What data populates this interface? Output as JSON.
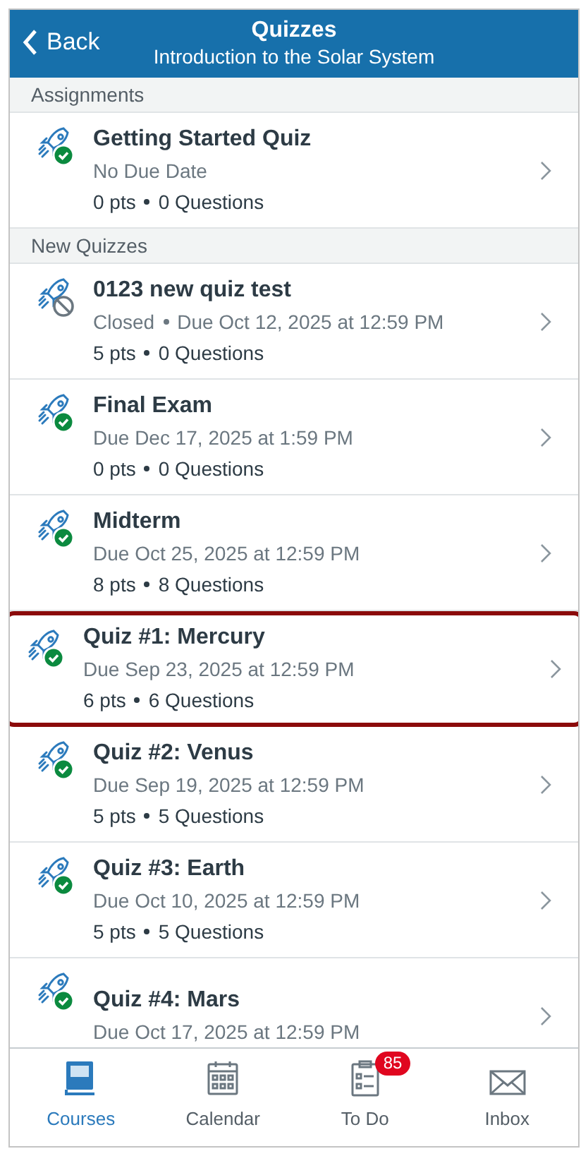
{
  "header": {
    "back": "Back",
    "title": "Quizzes",
    "subtitle": "Introduction to the Solar System"
  },
  "sections": [
    {
      "title": "Assignments",
      "items": [
        {
          "title": "Getting Started Quiz",
          "kind": "published",
          "highlighted": false,
          "details": [
            "No Due Date"
          ],
          "stats": [
            "0 pts",
            "0 Questions"
          ]
        }
      ]
    },
    {
      "title": "New Quizzes",
      "items": [
        {
          "title": "0123 new quiz test",
          "kind": "closed",
          "highlighted": false,
          "details": [
            "Closed",
            "Due Oct 12, 2025 at 12:59 PM"
          ],
          "stats": [
            "5 pts",
            "0 Questions"
          ]
        },
        {
          "title": "Final Exam",
          "kind": "published",
          "highlighted": false,
          "details": [
            "Due Dec 17, 2025 at 1:59 PM"
          ],
          "stats": [
            "0 pts",
            "0 Questions"
          ]
        },
        {
          "title": "Midterm",
          "kind": "published",
          "highlighted": false,
          "details": [
            "Due Oct 25, 2025 at 12:59 PM"
          ],
          "stats": [
            "8 pts",
            "8 Questions"
          ]
        },
        {
          "title": "Quiz #1: Mercury",
          "kind": "published",
          "highlighted": true,
          "details": [
            "Due Sep 23, 2025 at 12:59 PM"
          ],
          "stats": [
            "6 pts",
            "6 Questions"
          ]
        },
        {
          "title": "Quiz #2: Venus",
          "kind": "published",
          "highlighted": false,
          "details": [
            "Due Sep 19, 2025 at 12:59 PM"
          ],
          "stats": [
            "5 pts",
            "5 Questions"
          ]
        },
        {
          "title": "Quiz #3: Earth",
          "kind": "published",
          "highlighted": false,
          "details": [
            "Due Oct 10, 2025 at 12:59 PM"
          ],
          "stats": [
            "5 pts",
            "5 Questions"
          ]
        },
        {
          "title": "Quiz #4: Mars",
          "kind": "published",
          "highlighted": false,
          "details": [
            "Due Oct 17, 2025 at 12:59 PM"
          ]
        }
      ]
    }
  ],
  "tabs": [
    {
      "kind": "courses",
      "label": "Courses",
      "selected": true
    },
    {
      "kind": "calendar",
      "label": "Calendar",
      "selected": false
    },
    {
      "kind": "todo",
      "label": "To Do",
      "selected": false,
      "badge": "85"
    },
    {
      "kind": "inbox",
      "label": "Inbox",
      "selected": false
    }
  ]
}
